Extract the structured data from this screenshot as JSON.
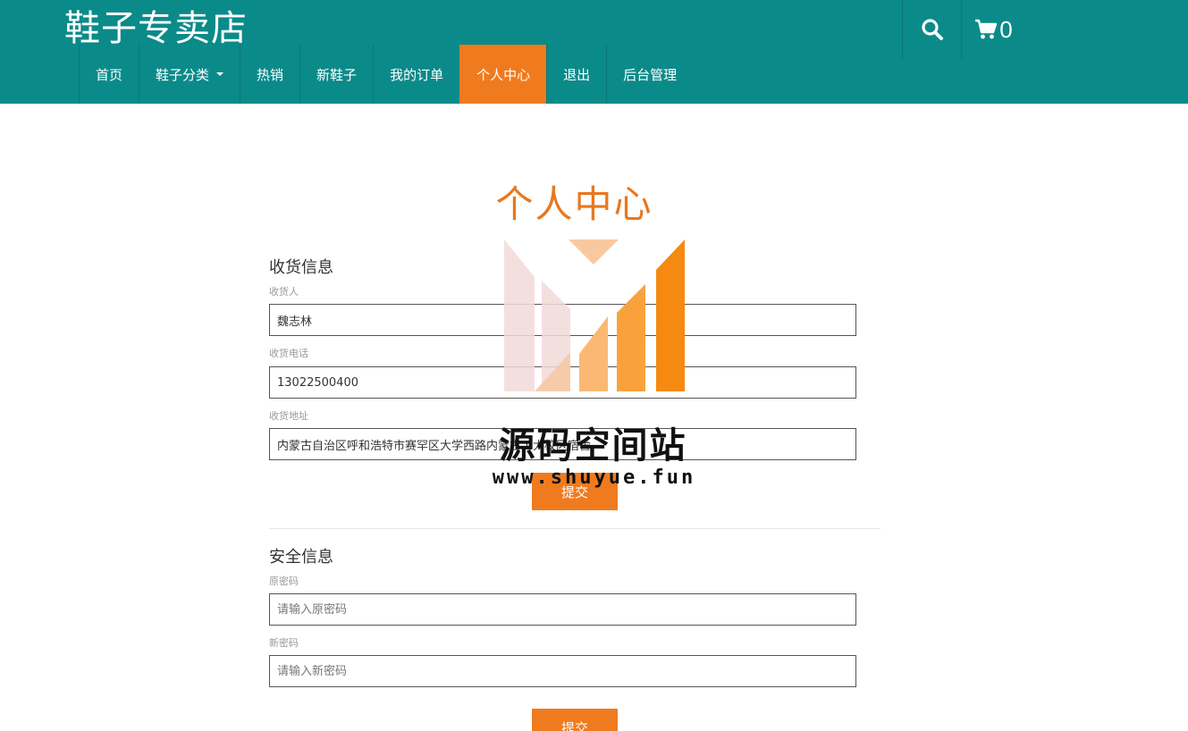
{
  "header": {
    "brand": "鞋子专卖店",
    "nav": [
      {
        "label": "首页"
      },
      {
        "label": "鞋子分类",
        "has_dropdown": true
      },
      {
        "label": "热销"
      },
      {
        "label": "新鞋子"
      },
      {
        "label": "我的订单"
      },
      {
        "label": "个人中心",
        "active": true
      },
      {
        "label": "退出"
      },
      {
        "label": "后台管理"
      }
    ],
    "search_icon": "search-icon",
    "cart_icon": "cart-icon",
    "cart_count": "0"
  },
  "main": {
    "title": "个人中心",
    "shipping": {
      "section_title": "收货信息",
      "name_label": "收货人",
      "name_value": "魏志林",
      "phone_label": "收货电话",
      "phone_value": "13022500400",
      "address_label": "收货地址",
      "address_value": "内蒙古自治区呼和浩特市赛罕区大学西路内蒙古工大校区宿舍",
      "submit_label": "提交"
    },
    "security": {
      "section_title": "安全信息",
      "old_pw_label": "原密码",
      "old_pw_placeholder": "请输入原密码",
      "new_pw_label": "新密码",
      "new_pw_placeholder": "请输入新密码",
      "submit_label": "提交"
    }
  },
  "watermark": {
    "text_cn": "源码空间站",
    "url": "www.shuyue.fun"
  },
  "colors": {
    "header_bg": "#0b8a8a",
    "accent": "#f07b1f",
    "title": "#e8781f"
  }
}
